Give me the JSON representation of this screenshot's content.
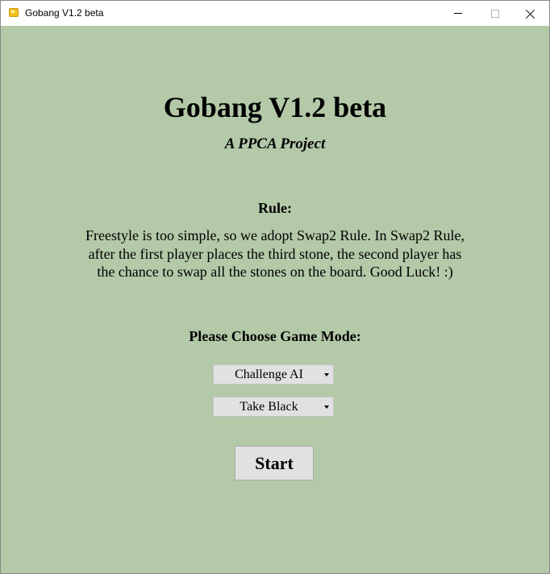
{
  "window": {
    "title": "Gobang V1.2 beta",
    "icon": "app-folder-icon",
    "controls": [
      "minimize-icon",
      "maximize-icon",
      "close-icon"
    ]
  },
  "colors": {
    "background": "#b3c9a8",
    "titlebar": "#ffffff",
    "control": "#e1e1e1"
  },
  "main": {
    "title": "Gobang V1.2 beta",
    "subtitle": "A PPCA Project",
    "rule_heading": "Rule:",
    "rule_text": "Freestyle is too simple, so we adopt Swap2 Rule. In Swap2 Rule, after the first player places the third stone, the second player has the chance to swap all the stones on the board. Good Luck! :)",
    "mode_heading": "Please Choose Game Mode:",
    "mode_select": {
      "value": "Challenge AI"
    },
    "color_select": {
      "value": "Take Black"
    },
    "start_label": "Start"
  }
}
